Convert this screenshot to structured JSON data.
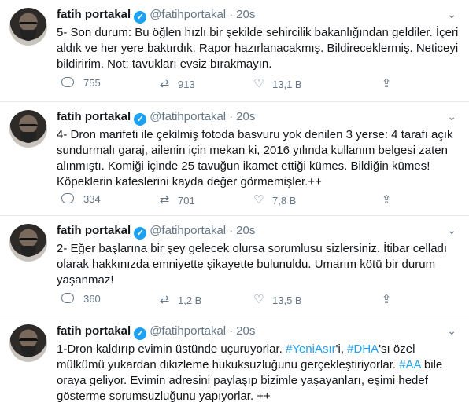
{
  "tweets": [
    {
      "name": "fatih portakal",
      "handle": "@fatihportakal",
      "separator": "·",
      "time": "20s",
      "text": "5- Son durum: Bu öğlen hızlı bir şekilde sehircilik bakanlığından geldiler. İçeri aldık ve her yere baktırdık. Rapor hazırlanacakmış. Bildireceklermiş. Neticeyi bildiririm. Not: tavukları evsiz bırakmayın.",
      "replies": "755",
      "retweets": "913",
      "likes": "13,1 B"
    },
    {
      "name": "fatih portakal",
      "handle": "@fatihportakal",
      "separator": "·",
      "time": "20s",
      "text": "4- Dron marifeti ile çekilmiş fotoda basvuru yok denilen 3 yerse: 4 tarafı açık sundurmalı garaj, ailenin için mekan ki, 2016 yılında kullanım belgesi zaten alınmıştı. Komiği içinde 25 tavuğun ikamet ettiği kümes. Bildiğin kümes! Köpeklerin kafeslerini kayda değer görmemişler.++",
      "replies": "334",
      "retweets": "701",
      "likes": "7,8 B"
    },
    {
      "name": "fatih portakal",
      "handle": "@fatihportakal",
      "separator": "·",
      "time": "20s",
      "text": "2- Eğer başlarına bir şey gelecek olursa sorumlusu sizlersiniz. İtibar celladı olarak hakkınızda emniyette şikayette bulunuldu. Umarım kötü bir durum yaşanmaz!",
      "replies": "360",
      "retweets": "1,2 B",
      "likes": "13,5 B"
    },
    {
      "name": "fatih portakal",
      "handle": "@fatihportakal",
      "separator": "·",
      "time": "20s",
      "text_parts": [
        "1-Dron kaldırıp evimin üstünde uçuruyorlar. ",
        "#YeniAsır",
        "'i, ",
        "#DHA",
        "'sı özel mülkümü yukardan dikizleme hukuksuzluğunu gerçekleştiriyorlar. ",
        "#AA",
        " bile oraya geliyor. Evimin adresini paylaşıp bizimle yaşayanları, eşimi hedef gösterme sorumsuzluğunu yapıyorlar. ++"
      ]
    }
  ],
  "icons": {
    "verified": "verified-badge-icon",
    "caret": "chevron-down-icon",
    "reply": "reply-icon",
    "retweet": "retweet-icon",
    "like": "heart-icon",
    "share": "share-icon"
  },
  "colors": {
    "accent": "#1da1f2",
    "muted": "#657786",
    "text": "#14171a",
    "divider": "#e6ecf0"
  }
}
